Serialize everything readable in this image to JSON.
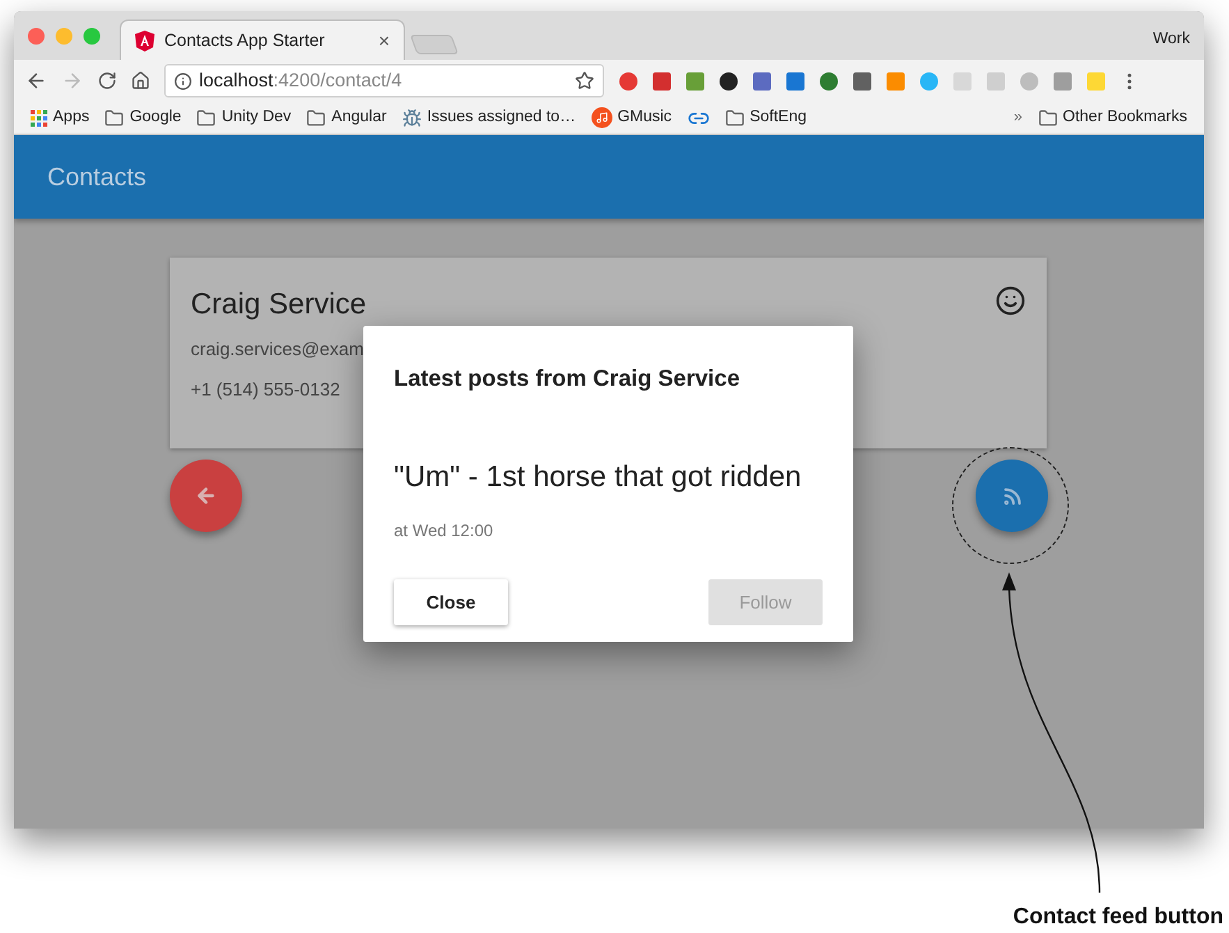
{
  "browser": {
    "profile": "Work",
    "tabs": [
      {
        "title": "Contacts App Starter",
        "close": "×",
        "selected": true
      }
    ],
    "address": {
      "host": "localhost",
      "path": ":4200/contact/4"
    },
    "bookmarks": [
      {
        "label": "Apps",
        "kind": "apps"
      },
      {
        "label": "Google",
        "kind": "folder"
      },
      {
        "label": "Unity Dev",
        "kind": "folder"
      },
      {
        "label": "Angular",
        "kind": "folder"
      },
      {
        "label": "Issues assigned to…",
        "kind": "bug"
      },
      {
        "label": "GMusic",
        "kind": "music"
      },
      {
        "kind": "link"
      },
      {
        "label": "SoftEng",
        "kind": "folder"
      }
    ],
    "overflow": "»",
    "other_bookmarks": "Other Bookmarks"
  },
  "app": {
    "title": "Contacts",
    "contact": {
      "name": "Craig Service",
      "email": "craig.services@exam",
      "phone": "+1 (514) 555-0132"
    },
    "dialog": {
      "title": "Latest posts from Craig Service",
      "post": "\"Um\" - 1st horse that got ridden",
      "time": "at Wed 12:00",
      "buttons": [
        {
          "label": "Close",
          "disabled": false
        },
        {
          "label": "Follow",
          "disabled": true
        }
      ]
    }
  },
  "annotation": {
    "label": "Contact feed button"
  }
}
